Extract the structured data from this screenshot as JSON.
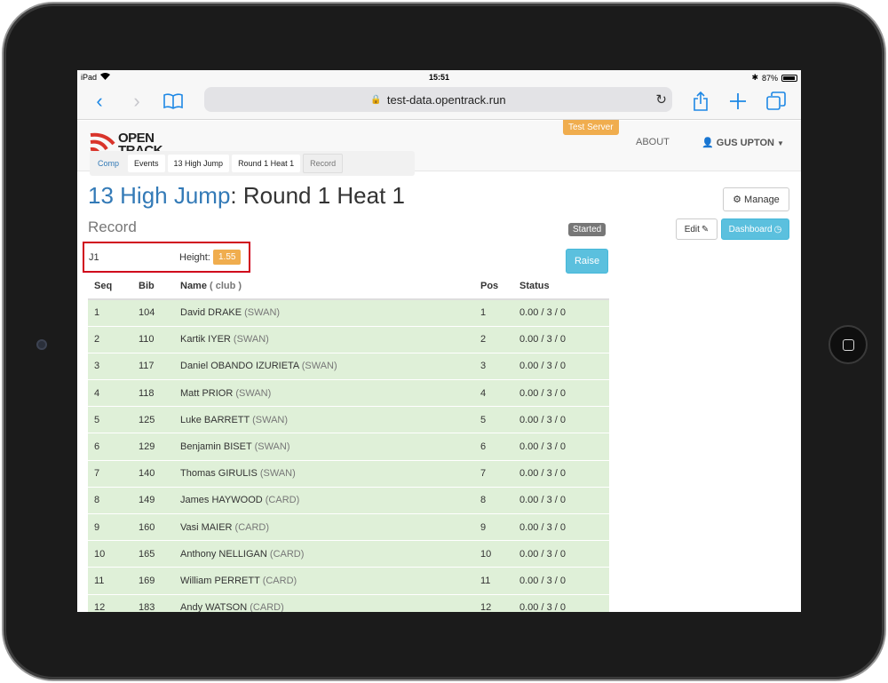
{
  "status_bar": {
    "device": "iPad",
    "time": "15:51",
    "battery": "87%"
  },
  "browser": {
    "url": "test-data.opentrack.run"
  },
  "header": {
    "logo_line1": "OPEN",
    "logo_line2": "TRACK",
    "test_server": "Test Server",
    "about": "ABOUT",
    "user": "GUS UPTON"
  },
  "breadcrumbs": [
    "Comp",
    "Events",
    "13 High Jump",
    "Round 1 Heat 1",
    "Record"
  ],
  "page": {
    "event": "13 High Jump",
    "sep": ": ",
    "round": "Round 1 Heat 1",
    "subtitle": "Record",
    "manage": "Manage",
    "started": "Started",
    "edit": "Edit",
    "dashboard": "Dashboard"
  },
  "judge": {
    "id": "J1",
    "height_label": "Height:",
    "height": "1.55"
  },
  "raise": "Raise",
  "table": {
    "headers": {
      "seq": "Seq",
      "bib": "Bib",
      "name": "Name",
      "club": "( club )",
      "pos": "Pos",
      "status": "Status"
    },
    "rows": [
      {
        "seq": "1",
        "bib": "104",
        "name": "David DRAKE",
        "club": "(SWAN)",
        "pos": "1",
        "status": "0.00 / 3 / 0"
      },
      {
        "seq": "2",
        "bib": "110",
        "name": "Kartik IYER",
        "club": "(SWAN)",
        "pos": "2",
        "status": "0.00 / 3 / 0"
      },
      {
        "seq": "3",
        "bib": "117",
        "name": "Daniel OBANDO IZURIETA",
        "club": "(SWAN)",
        "pos": "3",
        "status": "0.00 / 3 / 0"
      },
      {
        "seq": "4",
        "bib": "118",
        "name": "Matt PRIOR",
        "club": "(SWAN)",
        "pos": "4",
        "status": "0.00 / 3 / 0"
      },
      {
        "seq": "5",
        "bib": "125",
        "name": "Luke BARRETT",
        "club": "(SWAN)",
        "pos": "5",
        "status": "0.00 / 3 / 0"
      },
      {
        "seq": "6",
        "bib": "129",
        "name": "Benjamin BISET",
        "club": "(SWAN)",
        "pos": "6",
        "status": "0.00 / 3 / 0"
      },
      {
        "seq": "7",
        "bib": "140",
        "name": "Thomas GIRULIS",
        "club": "(SWAN)",
        "pos": "7",
        "status": "0.00 / 3 / 0"
      },
      {
        "seq": "8",
        "bib": "149",
        "name": "James HAYWOOD",
        "club": "(CARD)",
        "pos": "8",
        "status": "0.00 / 3 / 0"
      },
      {
        "seq": "9",
        "bib": "160",
        "name": "Vasi MAIER",
        "club": "(CARD)",
        "pos": "9",
        "status": "0.00 / 3 / 0"
      },
      {
        "seq": "10",
        "bib": "165",
        "name": "Anthony NELLIGAN",
        "club": "(CARD)",
        "pos": "10",
        "status": "0.00 / 3 / 0"
      },
      {
        "seq": "11",
        "bib": "169",
        "name": "William PERRETT",
        "club": "(CARD)",
        "pos": "11",
        "status": "0.00 / 3 / 0"
      },
      {
        "seq": "12",
        "bib": "183",
        "name": "Andy WATSON",
        "club": "(CARD)",
        "pos": "12",
        "status": "0.00 / 3 / 0"
      }
    ]
  },
  "colors": {
    "brand_red": "#d9342b",
    "link_blue": "#337ab7",
    "row_green": "#dff0d8",
    "warning": "#f0ad4e",
    "info": "#5bc0de"
  }
}
